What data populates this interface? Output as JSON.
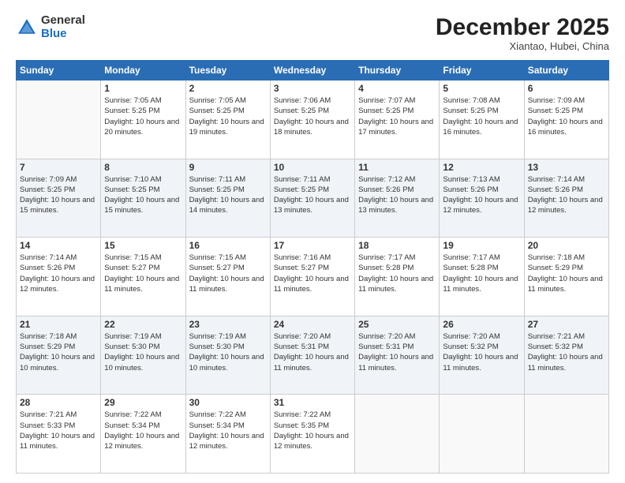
{
  "logo": {
    "general": "General",
    "blue": "Blue"
  },
  "header": {
    "month": "December 2025",
    "location": "Xiantao, Hubei, China"
  },
  "weekdays": [
    "Sunday",
    "Monday",
    "Tuesday",
    "Wednesday",
    "Thursday",
    "Friday",
    "Saturday"
  ],
  "weeks": [
    [
      {
        "day": "",
        "sunrise": "",
        "sunset": "",
        "daylight": ""
      },
      {
        "day": "1",
        "sunrise": "Sunrise: 7:05 AM",
        "sunset": "Sunset: 5:25 PM",
        "daylight": "Daylight: 10 hours and 20 minutes."
      },
      {
        "day": "2",
        "sunrise": "Sunrise: 7:05 AM",
        "sunset": "Sunset: 5:25 PM",
        "daylight": "Daylight: 10 hours and 19 minutes."
      },
      {
        "day": "3",
        "sunrise": "Sunrise: 7:06 AM",
        "sunset": "Sunset: 5:25 PM",
        "daylight": "Daylight: 10 hours and 18 minutes."
      },
      {
        "day": "4",
        "sunrise": "Sunrise: 7:07 AM",
        "sunset": "Sunset: 5:25 PM",
        "daylight": "Daylight: 10 hours and 17 minutes."
      },
      {
        "day": "5",
        "sunrise": "Sunrise: 7:08 AM",
        "sunset": "Sunset: 5:25 PM",
        "daylight": "Daylight: 10 hours and 16 minutes."
      },
      {
        "day": "6",
        "sunrise": "Sunrise: 7:09 AM",
        "sunset": "Sunset: 5:25 PM",
        "daylight": "Daylight: 10 hours and 16 minutes."
      }
    ],
    [
      {
        "day": "7",
        "sunrise": "Sunrise: 7:09 AM",
        "sunset": "Sunset: 5:25 PM",
        "daylight": "Daylight: 10 hours and 15 minutes."
      },
      {
        "day": "8",
        "sunrise": "Sunrise: 7:10 AM",
        "sunset": "Sunset: 5:25 PM",
        "daylight": "Daylight: 10 hours and 15 minutes."
      },
      {
        "day": "9",
        "sunrise": "Sunrise: 7:11 AM",
        "sunset": "Sunset: 5:25 PM",
        "daylight": "Daylight: 10 hours and 14 minutes."
      },
      {
        "day": "10",
        "sunrise": "Sunrise: 7:11 AM",
        "sunset": "Sunset: 5:25 PM",
        "daylight": "Daylight: 10 hours and 13 minutes."
      },
      {
        "day": "11",
        "sunrise": "Sunrise: 7:12 AM",
        "sunset": "Sunset: 5:26 PM",
        "daylight": "Daylight: 10 hours and 13 minutes."
      },
      {
        "day": "12",
        "sunrise": "Sunrise: 7:13 AM",
        "sunset": "Sunset: 5:26 PM",
        "daylight": "Daylight: 10 hours and 12 minutes."
      },
      {
        "day": "13",
        "sunrise": "Sunrise: 7:14 AM",
        "sunset": "Sunset: 5:26 PM",
        "daylight": "Daylight: 10 hours and 12 minutes."
      }
    ],
    [
      {
        "day": "14",
        "sunrise": "Sunrise: 7:14 AM",
        "sunset": "Sunset: 5:26 PM",
        "daylight": "Daylight: 10 hours and 12 minutes."
      },
      {
        "day": "15",
        "sunrise": "Sunrise: 7:15 AM",
        "sunset": "Sunset: 5:27 PM",
        "daylight": "Daylight: 10 hours and 11 minutes."
      },
      {
        "day": "16",
        "sunrise": "Sunrise: 7:15 AM",
        "sunset": "Sunset: 5:27 PM",
        "daylight": "Daylight: 10 hours and 11 minutes."
      },
      {
        "day": "17",
        "sunrise": "Sunrise: 7:16 AM",
        "sunset": "Sunset: 5:27 PM",
        "daylight": "Daylight: 10 hours and 11 minutes."
      },
      {
        "day": "18",
        "sunrise": "Sunrise: 7:17 AM",
        "sunset": "Sunset: 5:28 PM",
        "daylight": "Daylight: 10 hours and 11 minutes."
      },
      {
        "day": "19",
        "sunrise": "Sunrise: 7:17 AM",
        "sunset": "Sunset: 5:28 PM",
        "daylight": "Daylight: 10 hours and 11 minutes."
      },
      {
        "day": "20",
        "sunrise": "Sunrise: 7:18 AM",
        "sunset": "Sunset: 5:29 PM",
        "daylight": "Daylight: 10 hours and 11 minutes."
      }
    ],
    [
      {
        "day": "21",
        "sunrise": "Sunrise: 7:18 AM",
        "sunset": "Sunset: 5:29 PM",
        "daylight": "Daylight: 10 hours and 10 minutes."
      },
      {
        "day": "22",
        "sunrise": "Sunrise: 7:19 AM",
        "sunset": "Sunset: 5:30 PM",
        "daylight": "Daylight: 10 hours and 10 minutes."
      },
      {
        "day": "23",
        "sunrise": "Sunrise: 7:19 AM",
        "sunset": "Sunset: 5:30 PM",
        "daylight": "Daylight: 10 hours and 10 minutes."
      },
      {
        "day": "24",
        "sunrise": "Sunrise: 7:20 AM",
        "sunset": "Sunset: 5:31 PM",
        "daylight": "Daylight: 10 hours and 11 minutes."
      },
      {
        "day": "25",
        "sunrise": "Sunrise: 7:20 AM",
        "sunset": "Sunset: 5:31 PM",
        "daylight": "Daylight: 10 hours and 11 minutes."
      },
      {
        "day": "26",
        "sunrise": "Sunrise: 7:20 AM",
        "sunset": "Sunset: 5:32 PM",
        "daylight": "Daylight: 10 hours and 11 minutes."
      },
      {
        "day": "27",
        "sunrise": "Sunrise: 7:21 AM",
        "sunset": "Sunset: 5:32 PM",
        "daylight": "Daylight: 10 hours and 11 minutes."
      }
    ],
    [
      {
        "day": "28",
        "sunrise": "Sunrise: 7:21 AM",
        "sunset": "Sunset: 5:33 PM",
        "daylight": "Daylight: 10 hours and 11 minutes."
      },
      {
        "day": "29",
        "sunrise": "Sunrise: 7:22 AM",
        "sunset": "Sunset: 5:34 PM",
        "daylight": "Daylight: 10 hours and 12 minutes."
      },
      {
        "day": "30",
        "sunrise": "Sunrise: 7:22 AM",
        "sunset": "Sunset: 5:34 PM",
        "daylight": "Daylight: 10 hours and 12 minutes."
      },
      {
        "day": "31",
        "sunrise": "Sunrise: 7:22 AM",
        "sunset": "Sunset: 5:35 PM",
        "daylight": "Daylight: 10 hours and 12 minutes."
      },
      {
        "day": "",
        "sunrise": "",
        "sunset": "",
        "daylight": ""
      },
      {
        "day": "",
        "sunrise": "",
        "sunset": "",
        "daylight": ""
      },
      {
        "day": "",
        "sunrise": "",
        "sunset": "",
        "daylight": ""
      }
    ]
  ]
}
